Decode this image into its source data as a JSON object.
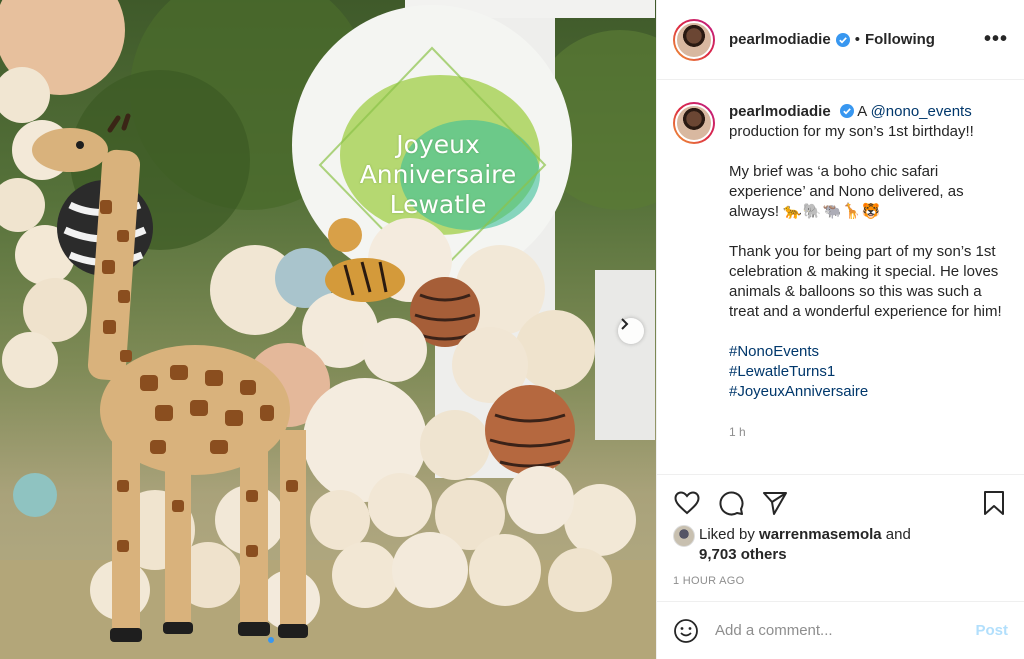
{
  "post": {
    "username": "pearlmodiadie",
    "follow_state": "Following",
    "separator": "•",
    "more_icon": "more-horizontal-icon"
  },
  "photo": {
    "sign_text_line1": "Joyeux",
    "sign_text_line2": "Anniversaire",
    "sign_text_line3": "Lewatle",
    "carousel_dot_count": 1
  },
  "caption": {
    "username": "pearlmodiadie",
    "line1_prefix": "A",
    "mention": "@nono_events",
    "line1_rest": "production for my son’s 1st birthday!!",
    "para2": "My brief was ‘a boho chic safari experience’ and Nono delivered, as always!",
    "para2_emoji": "🐆🐘🐃🦒🐯",
    "para3": "Thank you for being part of my son’s 1st celebration & making it special. He loves animals & balloons so this was such a treat and a wonderful experience for him!",
    "hashtags": [
      "#NonoEvents",
      "#LewatleTurns1",
      "#JoyeuxAnniversaire"
    ],
    "time": "1 h"
  },
  "likes": {
    "prefix": "Liked by",
    "user": "warrenmasemola",
    "connector": "and",
    "others": "9,703 others"
  },
  "posted_time": "1 HOUR AGO",
  "comment_box": {
    "placeholder": "Add a comment...",
    "post_label": "Post"
  },
  "colors": {
    "link": "#00376b",
    "verified": "#3897f0",
    "post_disabled": "#b2dffc",
    "muted": "#8e8e8e"
  }
}
